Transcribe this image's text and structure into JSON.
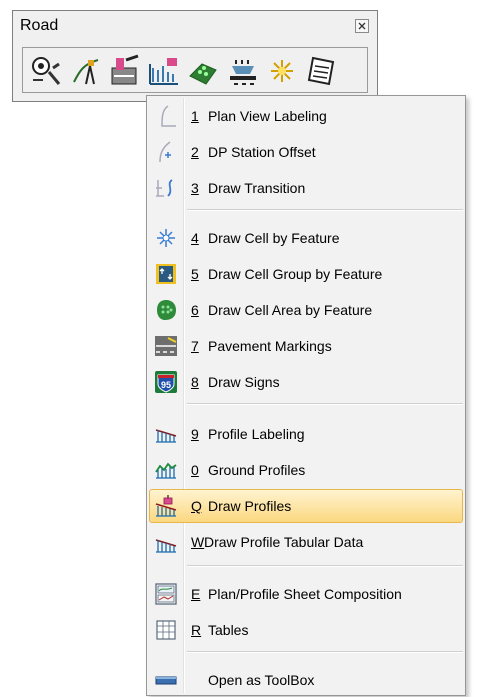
{
  "toolbar": {
    "title": "Road",
    "icons": [
      "survey-icon",
      "alignment-icon",
      "station-icon",
      "profile-icon",
      "cell-area-icon",
      "pavement-icon",
      "cell-icon",
      "tables-icon"
    ]
  },
  "menu": {
    "items": [
      {
        "key": "1",
        "label": "Plan View Labeling",
        "icon": "plan-view-labeling-icon"
      },
      {
        "key": "2",
        "label": "DP Station Offset",
        "icon": "station-offset-icon"
      },
      {
        "key": "3",
        "label": "Draw Transition",
        "icon": "transition-icon"
      },
      {
        "key": "4",
        "label": "Draw Cell by Feature",
        "icon": "cell-icon"
      },
      {
        "key": "5",
        "label": "Draw Cell Group by Feature",
        "icon": "cell-group-icon"
      },
      {
        "key": "6",
        "label": "Draw Cell Area by Feature",
        "icon": "cell-area-icon"
      },
      {
        "key": "7",
        "label": "Pavement Markings",
        "icon": "pavement-markings-icon"
      },
      {
        "key": "8",
        "label": "Draw Signs",
        "icon": "interstate-sign-icon"
      },
      {
        "key": "9",
        "label": "Profile Labeling",
        "icon": "profile-labeling-icon"
      },
      {
        "key": "0",
        "label": "Ground Profiles",
        "icon": "ground-profile-icon"
      },
      {
        "key": "Q",
        "label": "Draw Profiles",
        "icon": "draw-profiles-icon"
      },
      {
        "key": "W",
        "label": "Draw Profile Tabular Data",
        "icon": "profile-tabular-icon"
      },
      {
        "key": "E",
        "label": "Plan/Profile Sheet Composition",
        "icon": "sheet-composition-icon"
      },
      {
        "key": "R",
        "label": "Tables",
        "icon": "tables-icon"
      },
      {
        "key": "",
        "label": "Open as ToolBox",
        "icon": "toolbox-icon"
      }
    ],
    "highlighted_item": "Draw Profiles",
    "sign_number": "95"
  },
  "colors": {
    "highlight_top": "#fff3d0",
    "highlight_bottom": "#fbd880",
    "highlight_border": "#e8b74a",
    "menu_bg": "#f2f2f2"
  }
}
